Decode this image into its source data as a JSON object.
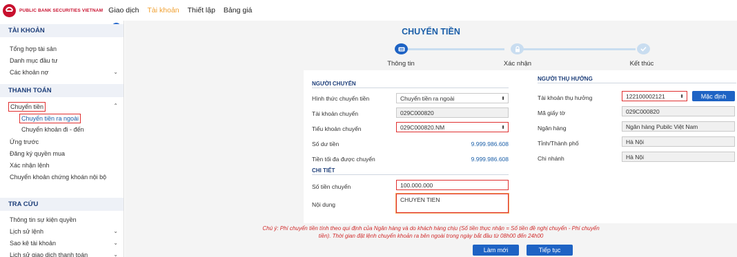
{
  "brand": {
    "name": "PUBLIC BANK SECURITIES VIETNAM",
    "color": "#c8102e"
  },
  "topnav": [
    {
      "label": "Giao dịch",
      "active": false
    },
    {
      "label": "Tài khoản",
      "active": true
    },
    {
      "label": "Thiết lập",
      "active": false
    },
    {
      "label": "Bảng giá",
      "active": false
    }
  ],
  "sidebar": {
    "tai_khoan": {
      "title": "TÀI KHOẢN",
      "items": [
        "Tổng hợp tài sản",
        "Danh mục đầu tư",
        "Các khoản nợ"
      ]
    },
    "thanh_toan": {
      "title": "THANH TOÁN",
      "chuyen_tien": "Chuyển tiền",
      "sub_items": [
        "Chuyển tiền ra ngoài",
        "Chuyển khoản đi - đến"
      ],
      "items": [
        "Ứng trước",
        "Đăng ký quyền mua",
        "Xác nhận lệnh",
        "Chuyển khoản chứng khoán nội bộ"
      ]
    },
    "tra_cuu": {
      "title": "TRA CỨU",
      "items": [
        "Thông tin sự kiện quyền",
        "Lịch sử lệnh",
        "Sao kê tài khoản",
        "Lịch sử giao dịch thanh toán"
      ]
    }
  },
  "main": {
    "title": "CHUYỂN TIỀN",
    "steps": [
      "Thông tin",
      "Xác nhận",
      "Kết thúc"
    ],
    "nguoi_chuyen": {
      "title": "NGƯỜI CHUYỂN",
      "hinh_thuc_label": "Hình thức chuyển tiền",
      "hinh_thuc_value": "Chuyển tiền ra ngoài",
      "tai_khoan_label": "Tài khoản chuyển",
      "tai_khoan_value": "029C000820",
      "tieu_khoan_label": "Tiểu khoản chuyển",
      "tieu_khoan_value": "029C000820.NM",
      "so_du_label": "Số dư tiền",
      "so_du_value": "9.999.986.608",
      "toi_da_label": "Tiền tối đa được chuyển",
      "toi_da_value": "9.999.986.608"
    },
    "chi_tiet": {
      "title": "CHI TIẾT",
      "so_tien_label": "Số tiền chuyển",
      "so_tien_value": "100.000.000",
      "noi_dung_label": "Nội dung",
      "noi_dung_value": "CHUYEN TIEN"
    },
    "nguoi_thu_huong": {
      "title": "NGƯỜI THỤ HƯỞNG",
      "tai_khoan_label": "Tài khoản thụ hưởng",
      "tai_khoan_value": "122100002121",
      "mac_dinh_button": "Mặc định",
      "ma_giay_to_label": "Mã giấy tờ",
      "ma_giay_to_value": "029C000820",
      "ngan_hang_label": "Ngân hàng",
      "ngan_hang_value": "Ngân hàng Pubilc Việt Nam",
      "tinh_label": "Tỉnh/Thành phố",
      "tinh_value": "Hà Nội",
      "chi_nhanh_label": "Chi nhánh",
      "chi_nhanh_value": "Hà Nội"
    },
    "note_line1": "Chú ý: Phí chuyển tiền tính theo qui định của Ngân hàng và do khách hàng chịu (Số tiền thực nhận = Số tiền đề nghị chuyển - Phí chuyển",
    "note_line2": "tiền). Thời gian đặt lệnh chuyển khoản ra bên ngoài trong ngày bắt đầu từ 08h00 đến 24h00",
    "lam_moi_button": "Làm mới",
    "tiep_tuc_button": "Tiếp tục"
  },
  "colors": {
    "accent": "#1e63c4",
    "title": "#1a5ea8",
    "active_nav": "#f0a030",
    "error_border": "#e03030",
    "note": "#d02a2a"
  },
  "icons": [
    "logo-icon",
    "collapse-sidebar-icon",
    "chevron-down-icon",
    "chevron-up-icon",
    "keyboard-icon",
    "lock-icon",
    "check-icon"
  ]
}
